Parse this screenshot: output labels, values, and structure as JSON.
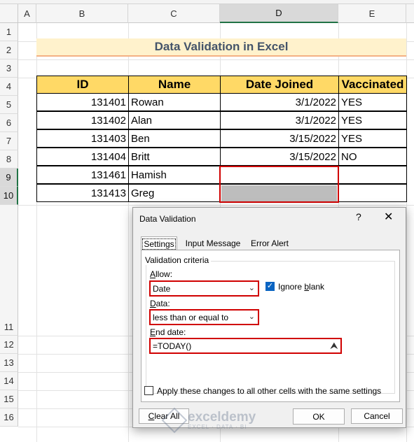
{
  "columns": [
    "A",
    "B",
    "C",
    "D",
    "E"
  ],
  "selected_column": "D",
  "rows": [
    "1",
    "2",
    "3",
    "4",
    "5",
    "6",
    "7",
    "8",
    "9",
    "10",
    "11",
    "12",
    "13",
    "14",
    "15",
    "16"
  ],
  "sheet": {
    "title": "Data Validation in Excel",
    "headers": [
      "ID",
      "Name",
      "Date Joined",
      "Vaccinated"
    ],
    "records": [
      [
        "131401",
        "Rowan",
        "3/1/2022",
        "YES"
      ],
      [
        "131402",
        "Alan",
        "3/1/2022",
        "YES"
      ],
      [
        "131403",
        "Ben",
        "3/15/2022",
        "YES"
      ],
      [
        "131404",
        "Britt",
        "3/15/2022",
        "NO"
      ],
      [
        "131461",
        "Hamish",
        "",
        ""
      ],
      [
        "131413",
        "Greg",
        "",
        ""
      ]
    ]
  },
  "dialog": {
    "title": "Data Validation",
    "help": "?",
    "close": "✕",
    "tabs": [
      "Settings",
      "Input Message",
      "Error Alert"
    ],
    "group_label": "Validation criteria",
    "allow_label_pre": "",
    "allow_label_u": "A",
    "allow_label_post": "llow:",
    "allow_value": "Date",
    "ignore_blank_pre": "Ignore ",
    "ignore_blank_u": "b",
    "ignore_blank_post": "lank",
    "ignore_blank_checked": true,
    "data_label_u": "D",
    "data_label_post": "ata:",
    "data_value": "less than or equal to",
    "end_date_label_u": "E",
    "end_date_label_post": "nd date:",
    "end_date_value": "=TODAY()",
    "apply_pre": "Apply these changes to all other cells with the same settings",
    "apply_checked": false,
    "clear_all_u": "C",
    "clear_all_post": "lear All",
    "ok_label": "OK",
    "cancel_label": "Cancel"
  },
  "watermark": {
    "name": "exceldemy",
    "tagline": "EXCEL · DATA · BI"
  },
  "colors": {
    "header_fill": "#ffd966",
    "title_fill": "#fff2cc",
    "highlight_red": "#d00000",
    "accent_blue": "#0a64c2"
  }
}
